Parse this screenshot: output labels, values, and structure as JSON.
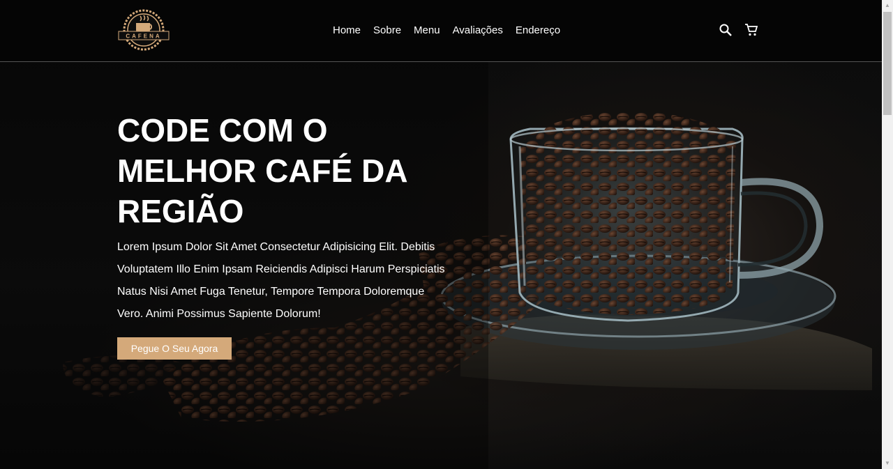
{
  "brand": {
    "logo_text": "CAFENA"
  },
  "nav": {
    "items": [
      {
        "label": "Home"
      },
      {
        "label": "Sobre"
      },
      {
        "label": "Menu"
      },
      {
        "label": "Avaliações"
      },
      {
        "label": "Endereço"
      }
    ]
  },
  "header_icons": {
    "search": "search-icon",
    "cart": "cart-icon"
  },
  "hero": {
    "title_lines": [
      "CODE COM O",
      "MELHOR CAFÉ DA",
      "REGIÃO"
    ],
    "description_lines": [
      "Lorem Ipsum Dolor Sit Amet Consectetur Adipisicing Elit. Debitis",
      "Voluptatem Illo Enim Ipsam Reiciendis Adipisci Harum Perspiciatis",
      "Natus Nisi Amet Fuga Tenetur, Tempore Tempora Doloremque",
      "Vero. Animi Possimus Sapiente Dolorum!"
    ],
    "cta_label": "Pegue O Seu Agora"
  },
  "colors": {
    "accent": "#d4a97a",
    "header_bg": "#050505",
    "text": "#ffffff"
  }
}
